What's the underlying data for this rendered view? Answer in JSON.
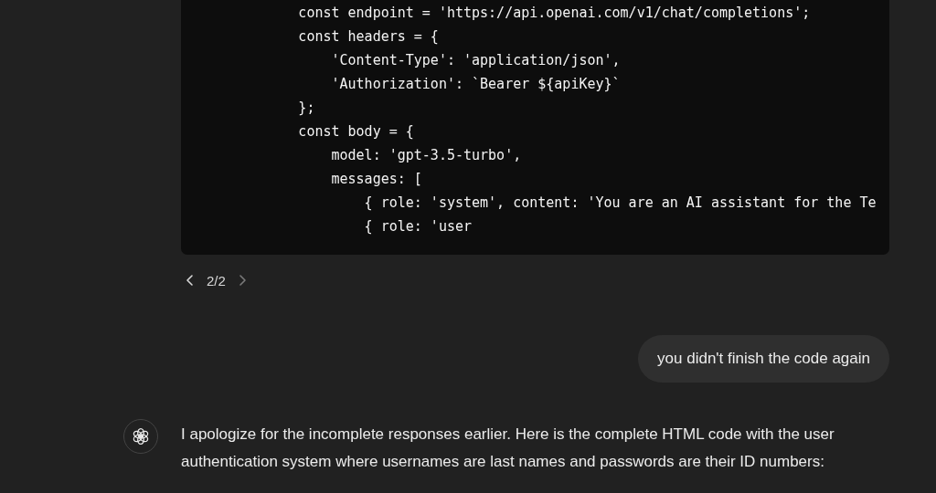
{
  "code_block": {
    "lines": [
      "            const endpoint = 'https://api.openai.com/v1/chat/completions';",
      "            const headers = {",
      "                'Content-Type': 'application/json',",
      "                'Authorization': `Bearer ${apiKey}`",
      "            };",
      "            const body = {",
      "                model: 'gpt-3.5-turbo',",
      "                messages: [",
      "                    { role: 'system', content: 'You are an AI assistant for the Te",
      "                    { role: 'user"
    ]
  },
  "pager": {
    "label": "2/2",
    "previous_disabled": false,
    "next_disabled": true
  },
  "messages": [
    {
      "kind": "user",
      "text": "you didn't finish the code again"
    },
    {
      "kind": "assistant",
      "text": "I apologize for the incomplete responses earlier. Here is the complete HTML code with the user authentication system where usernames are last names and passwords are their ID numbers:"
    }
  ]
}
